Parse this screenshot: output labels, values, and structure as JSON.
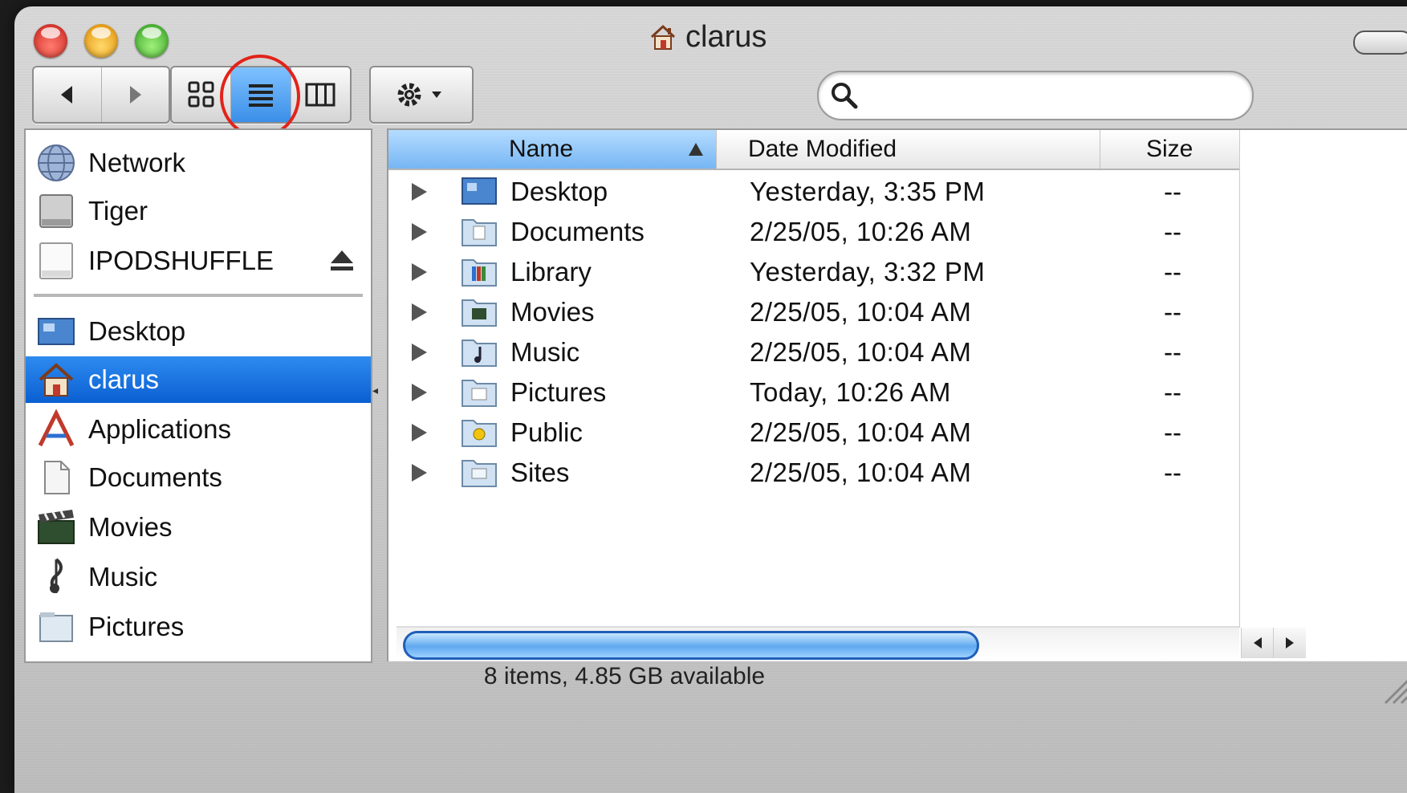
{
  "window": {
    "title": "clarus",
    "title_icon": "house-icon"
  },
  "toolbar": {
    "back_icon": "back-arrow-icon",
    "forward_icon": "forward-arrow-icon",
    "view_modes": [
      "icon-view-icon",
      "list-view-icon",
      "column-view-icon"
    ],
    "active_view": "list",
    "action_icon": "gear-icon",
    "search_placeholder": ""
  },
  "sidebar": {
    "devices": [
      {
        "label": "Network",
        "icon": "network-globe-icon"
      },
      {
        "label": "Tiger",
        "icon": "hard-disk-icon"
      },
      {
        "label": "IPODSHUFFLE",
        "icon": "ipod-drive-icon",
        "ejectable": true
      }
    ],
    "places": [
      {
        "label": "Desktop",
        "icon": "desktop-folder-icon"
      },
      {
        "label": "clarus",
        "icon": "home-icon",
        "selected": true
      },
      {
        "label": "Applications",
        "icon": "applications-icon"
      },
      {
        "label": "Documents",
        "icon": "documents-icon"
      },
      {
        "label": "Movies",
        "icon": "movies-icon"
      },
      {
        "label": "Music",
        "icon": "music-icon"
      },
      {
        "label": "Pictures",
        "icon": "pictures-icon"
      }
    ]
  },
  "list": {
    "columns": {
      "name": "Name",
      "date": "Date Modified",
      "size": "Size"
    },
    "sort_column": "name",
    "rows": [
      {
        "name": "Desktop",
        "date": "Yesterday, 3:35 PM",
        "size": "--"
      },
      {
        "name": "Documents",
        "date": "2/25/05, 10:26 AM",
        "size": "--"
      },
      {
        "name": "Library",
        "date": "Yesterday, 3:32 PM",
        "size": "--"
      },
      {
        "name": "Movies",
        "date": "2/25/05, 10:04 AM",
        "size": "--"
      },
      {
        "name": "Music",
        "date": "2/25/05, 10:04 AM",
        "size": "--"
      },
      {
        "name": "Pictures",
        "date": "Today, 10:26 AM",
        "size": "--"
      },
      {
        "name": "Public",
        "date": "2/25/05, 10:04 AM",
        "size": "--"
      },
      {
        "name": "Sites",
        "date": "2/25/05, 10:04 AM",
        "size": "--"
      }
    ]
  },
  "status_bar": {
    "text": "8 items, 4.85 GB available"
  },
  "colors": {
    "selection": "#0a5fd1",
    "header_sorted": "#76b6f4",
    "highlight_ring": "#e2231a"
  }
}
